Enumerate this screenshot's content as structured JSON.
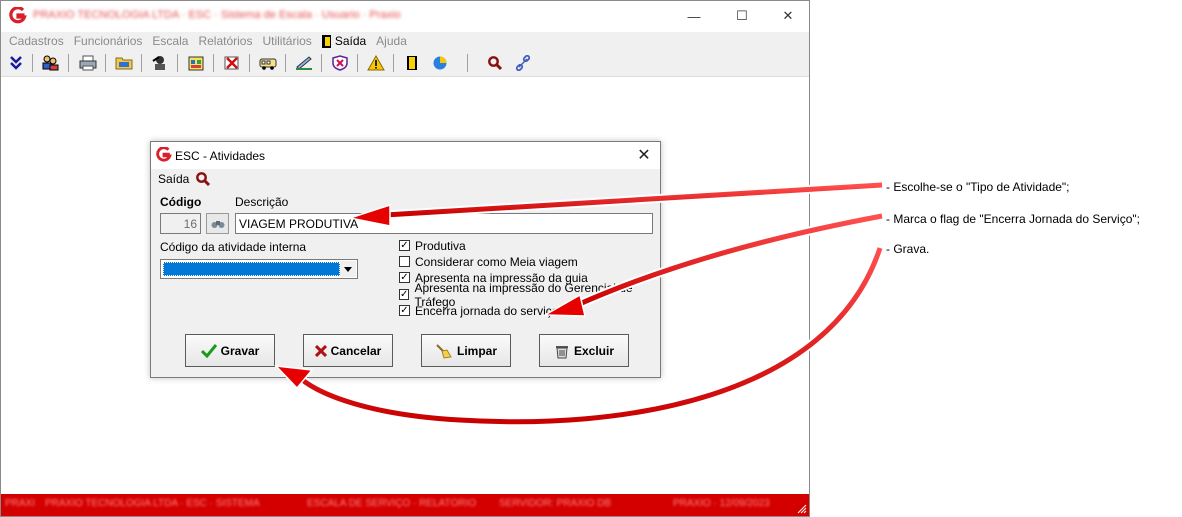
{
  "app": {
    "title": "PRAXIO TECNOLOGIA LTDA · ESC · Sistema de Escala · Usuario · Praxio",
    "window_controls": {
      "minimize": "—",
      "maximize": "☐",
      "close": "✕"
    }
  },
  "menu": {
    "items": [
      "Cadastros",
      "Funcionários",
      "Escala",
      "Relatórios",
      "Utilitários",
      "Saída",
      "Ajuda"
    ],
    "active": "Saída"
  },
  "toolbar": {
    "icons": [
      "double-down-arrow-icon",
      "people-icon",
      "printer-icon",
      "folder-icon",
      "worker-icon",
      "schedule-icon",
      "cancel-card-icon",
      "bus-icon",
      "notepad-icon",
      "shield-icon",
      "warning-icon",
      "exit-door-icon",
      "pie-chart-icon",
      "search-icon",
      "link-icon"
    ]
  },
  "statusbar": {
    "segments": [
      "PRAXIO",
      "PRAXIO TECNOLOGIA LTDA · ESC · SISTEMA",
      "ESCALA DE SERVIÇO · RELATÓRIO",
      "SERVIDOR: PRAXIO DB",
      "PRAXIO · 12/09/2023"
    ]
  },
  "dialog": {
    "title": "ESC - Atividades",
    "menu_label": "Saída",
    "codigo_label": "Código",
    "codigo_value": "16",
    "descricao_label": "Descrição",
    "descricao_value": "VIAGEM PRODUTIVA",
    "codigo_interna_label": "Código da atividade interna",
    "codigo_interna_value": "",
    "checkboxes": [
      {
        "label": "Produtiva",
        "checked": true
      },
      {
        "label": "Considerar como Meia viagem",
        "checked": false
      },
      {
        "label": "Apresenta na impressão da guia",
        "checked": true
      },
      {
        "label": "Apresenta na impressão do Gerencial de Tráfego",
        "checked": true
      },
      {
        "label": "Encerra jornada do serviço",
        "checked": true
      }
    ],
    "buttons": {
      "save": "Gravar",
      "cancel": "Cancelar",
      "clear": "Limpar",
      "delete": "Excluir"
    }
  },
  "annotations": [
    "- Escolhe-se o \"Tipo de Atividade\";",
    "- Marca o flag de \"Encerra Jornada do Serviço\";",
    "- Grava."
  ],
  "colors": {
    "arrow": "#e60000",
    "statusbar": "#d40000",
    "selection": "#0078d7",
    "logo": "#d9202a"
  }
}
